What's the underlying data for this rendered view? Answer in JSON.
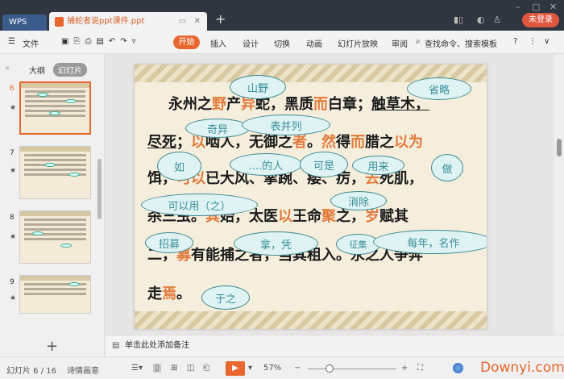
{
  "window": {
    "app_tab": "WPS",
    "doc_tab": "捕蛇者说ppt课件.ppt",
    "login": "未登录",
    "new_tab": "+"
  },
  "toolbar": {
    "menu": "文件",
    "tabs": [
      "开始",
      "插入",
      "设计",
      "切换",
      "动画",
      "幻灯片放映",
      "审阅"
    ],
    "search": "查找命令、搜索模板",
    "help": "?"
  },
  "sidebar": {
    "tabs": [
      "大纲",
      "幻灯片"
    ],
    "slides": [
      {
        "num": "6",
        "star": "★"
      },
      {
        "num": "7",
        "star": "★"
      },
      {
        "num": "8",
        "star": "★"
      },
      {
        "num": "9",
        "star": "★"
      }
    ],
    "add": "+"
  },
  "slide": {
    "lines": [
      [
        {
          "t": "永州之"
        },
        {
          "t": "野",
          "h": 1
        },
        {
          "t": "产"
        },
        {
          "t": "异",
          "h": 1
        },
        {
          "t": "蛇，黑质"
        },
        {
          "t": "而",
          "h": 1
        },
        {
          "t": "白章；"
        },
        {
          "t": "触草木，",
          "u": 1
        }
      ],
      [
        {
          "t": "尽死",
          "u": 1
        },
        {
          "t": "；"
        },
        {
          "t": "以",
          "h": 1
        },
        {
          "t": "啮人，无御之"
        },
        {
          "t": "者",
          "h": 1
        },
        {
          "t": "。"
        },
        {
          "t": "然",
          "h": 1
        },
        {
          "t": "得"
        },
        {
          "t": "而",
          "h": 1
        },
        {
          "t": "腊之"
        },
        {
          "t": "以为",
          "h": 1
        }
      ],
      [
        {
          "t": "饵，"
        },
        {
          "t": "可以",
          "h": 1
        },
        {
          "t": "已大风、挛踠、瘘、疠，"
        },
        {
          "t": "去",
          "h": 1
        },
        {
          "t": "死肌，"
        }
      ],
      [
        {
          "t": "杀三虫。"
        },
        {
          "t": "其",
          "h": 1
        },
        {
          "t": "始，太医"
        },
        {
          "t": "以",
          "h": 1
        },
        {
          "t": "王命"
        },
        {
          "t": "聚",
          "h": 1
        },
        {
          "t": "之，"
        },
        {
          "t": "岁",
          "h": 1
        },
        {
          "t": "赋其"
        }
      ],
      [
        {
          "t": "二，"
        },
        {
          "t": "募",
          "h": 1
        },
        {
          "t": "有能捕之者，当其租入。永之人争奔"
        }
      ],
      [
        {
          "t": "走"
        },
        {
          "t": "焉",
          "h": 1
        },
        {
          "t": "。"
        }
      ]
    ],
    "callouts": [
      "山野",
      "省略",
      "奇异",
      "表并列",
      "如",
      "....的人",
      "可是",
      "用来",
      "做",
      "可以用（之）",
      "消除",
      "招募",
      "拿，凭",
      "征集",
      "每年，名作",
      "于之"
    ]
  },
  "notes": {
    "placeholder": "单击此处添加备注"
  },
  "status": {
    "slide_counter": "幻灯片 6 / 16",
    "theme": "诗情画意",
    "zoom": "57%",
    "watermark": "Downyi.com"
  },
  "colors": {
    "accent": "#e8672f",
    "highlight": "#e27a3a",
    "callout_border": "#3f8a8f"
  }
}
